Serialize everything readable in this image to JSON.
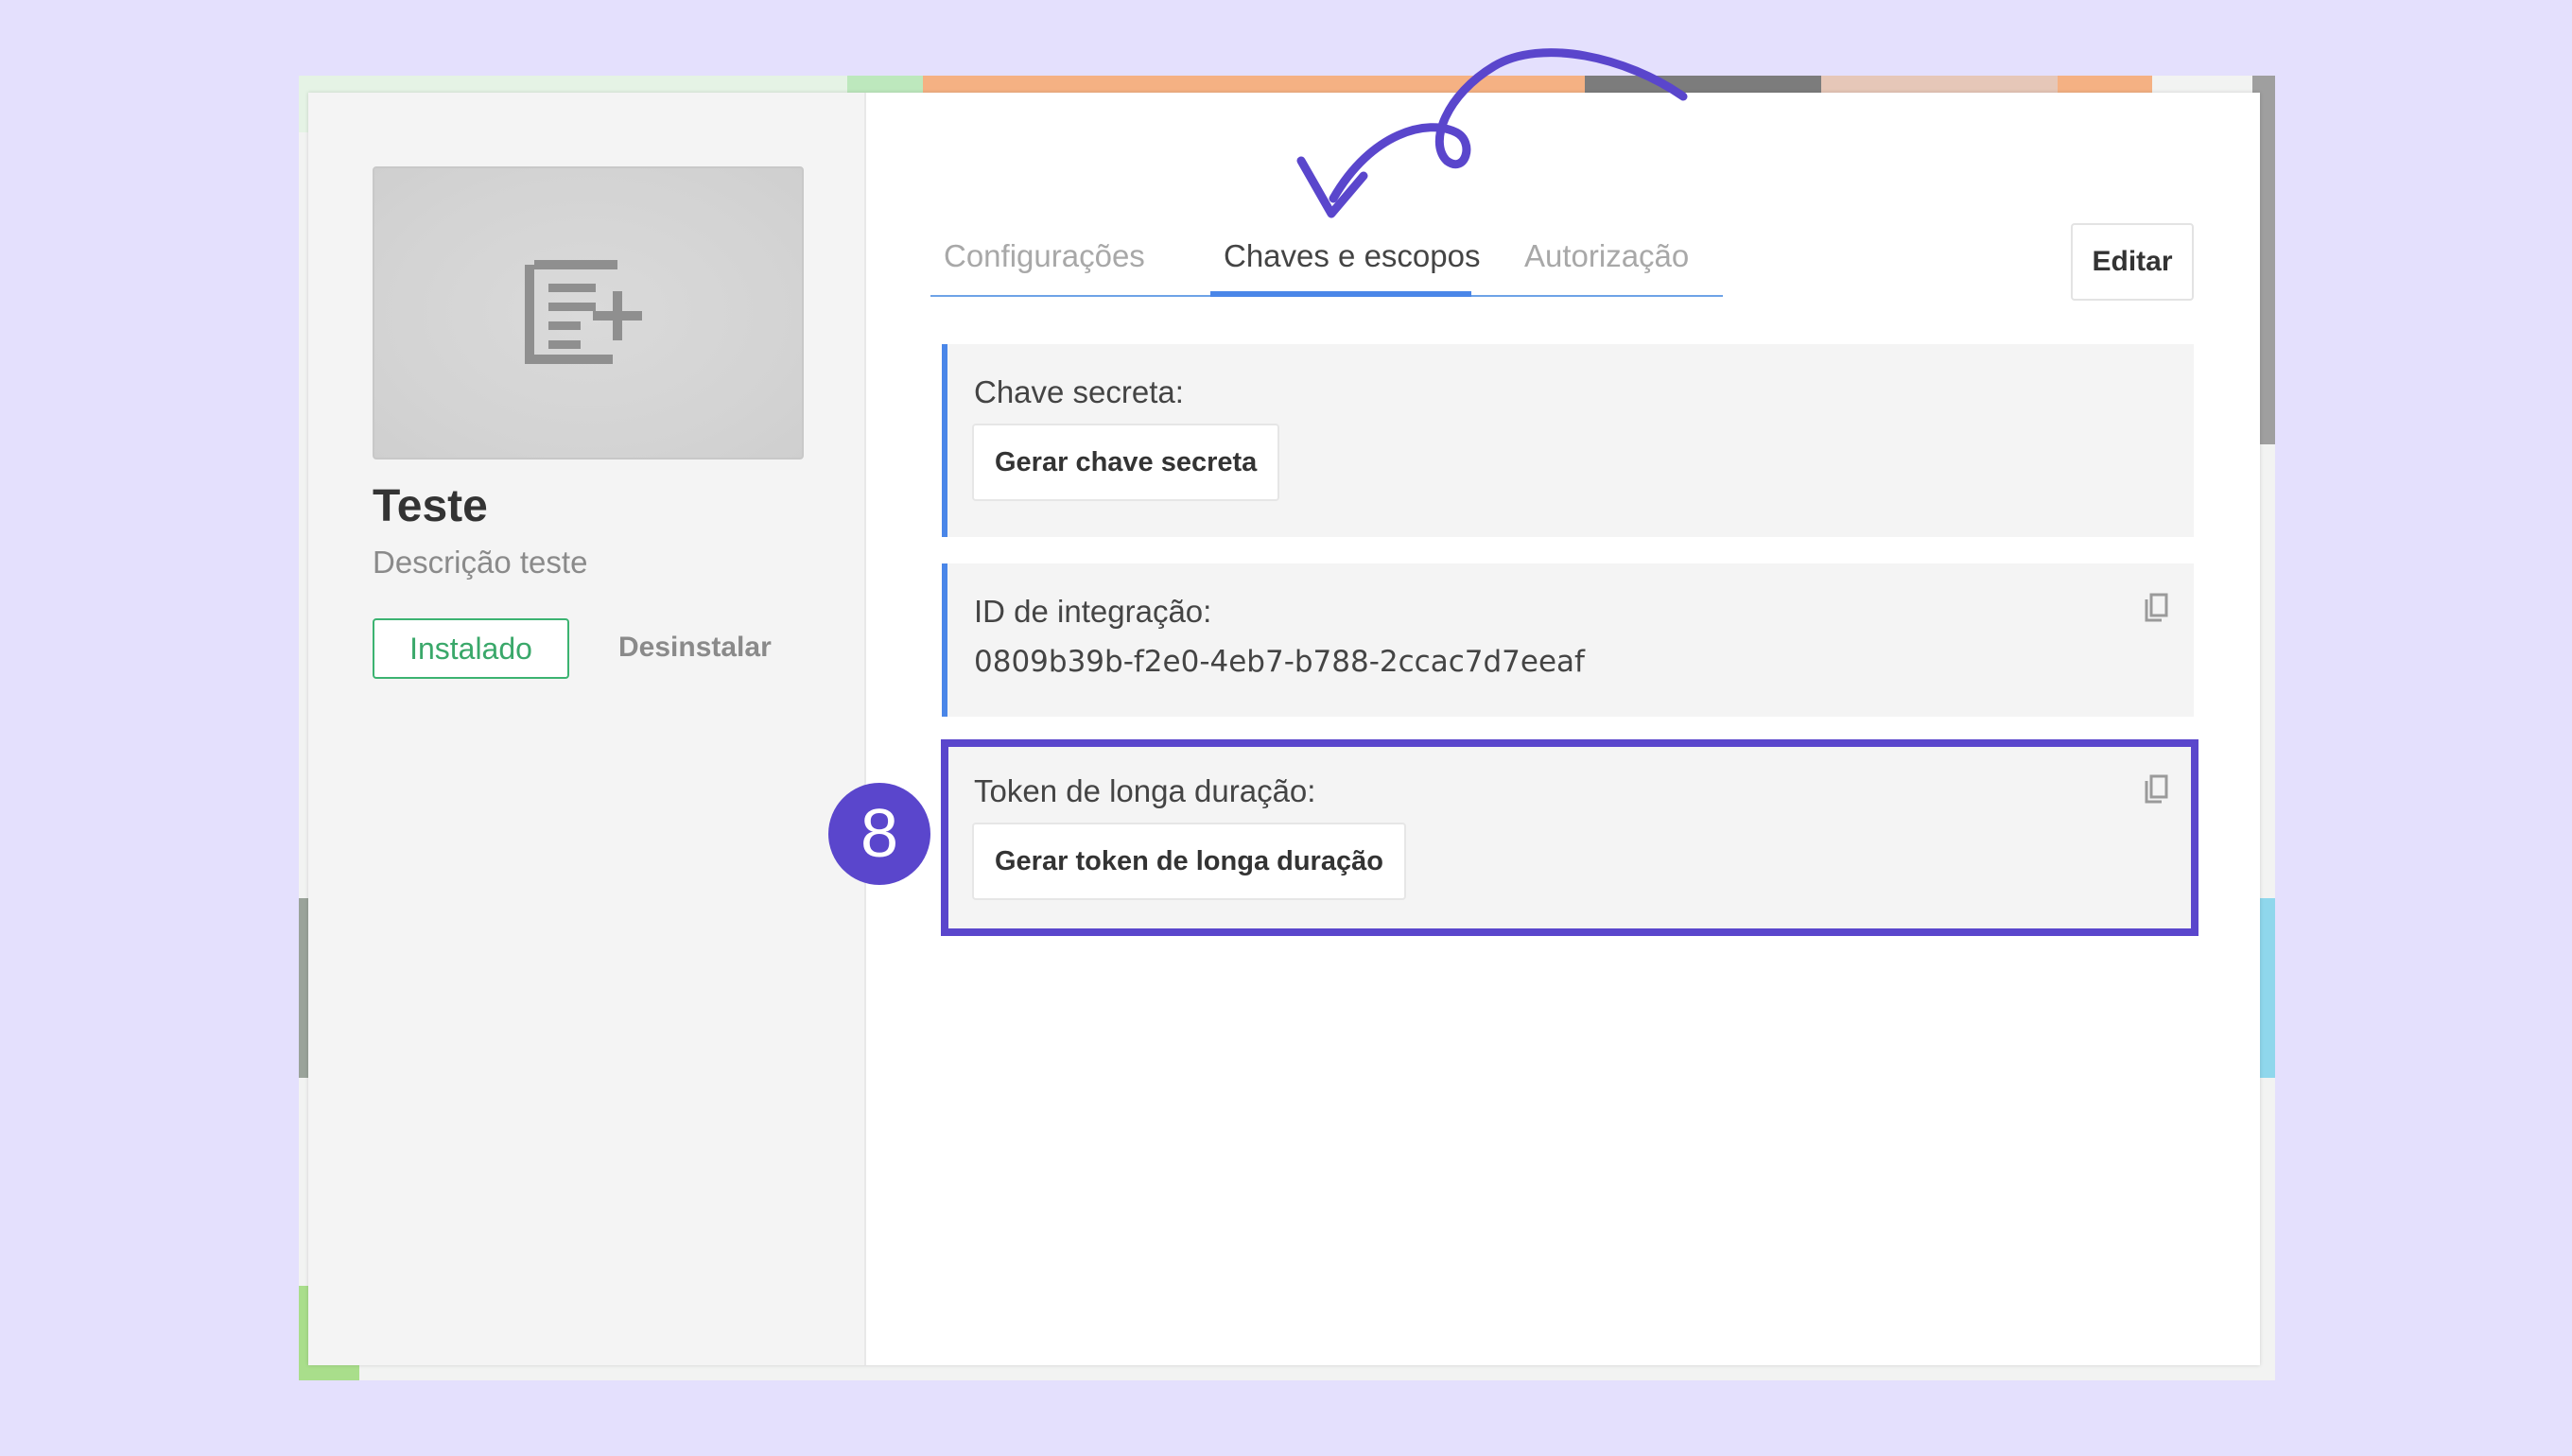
{
  "app": {
    "title": "Teste",
    "description": "Descrição teste",
    "installed_label": "Instalado",
    "uninstall_label": "Desinstalar"
  },
  "tabs": [
    {
      "label": "Configurações",
      "active": false
    },
    {
      "label": "Chaves e escopos",
      "active": true
    },
    {
      "label": "Autorização",
      "active": false
    }
  ],
  "edit_label": "Editar",
  "sections": {
    "secret_key": {
      "label": "Chave secreta:",
      "button_label": "Gerar chave secreta"
    },
    "integration_id": {
      "label": "ID de integração:",
      "value": "0809b39b-f2e0-4eb7-b788-2ccac7d7eeaf"
    },
    "long_token": {
      "label": "Token de longa duração:",
      "button_label": "Gerar token de longa duração"
    }
  },
  "annotation": {
    "step_number": "8",
    "color": "#5a46cc"
  },
  "colors": {
    "accent": "#4a86e8",
    "installed": "#3cb371",
    "background": "#e4e0fd"
  },
  "icons": [
    "add-list-icon",
    "copy-icon",
    "arrow-icon"
  ]
}
